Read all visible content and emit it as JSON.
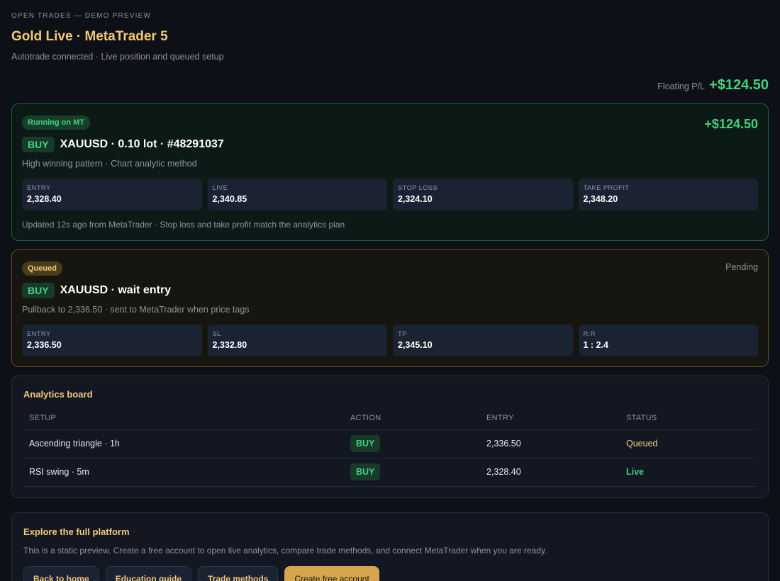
{
  "header": {
    "eyebrow": "OPEN TRADES — DEMO PREVIEW",
    "title": "Gold Live · MetaTrader 5",
    "subtitle": "Autotrade connected · Live position and queued setup",
    "floating_label": "Floating P/L",
    "floating_value": "+$124.50"
  },
  "live_card": {
    "status": "Running on MT",
    "pl": "+$124.50",
    "side": "BUY",
    "title": "XAUUSD · 0.10 lot · #48291037",
    "description": "High winning pattern · Chart analytic method",
    "metrics": [
      {
        "label": "ENTRY",
        "value": "2,328.40"
      },
      {
        "label": "LIVE",
        "value": "2,340.85"
      },
      {
        "label": "STOP LOSS",
        "value": "2,324.10"
      },
      {
        "label": "TAKE PROFIT",
        "value": "2,348.20"
      }
    ],
    "footer": "Updated 12s ago from MetaTrader · Stop loss and take profit match the analytics plan"
  },
  "queued_card": {
    "status": "Queued",
    "state": "Pending",
    "side": "BUY",
    "title": "XAUUSD · wait entry",
    "description": "Pullback to 2,336.50 · sent to MetaTrader when price tags",
    "metrics": [
      {
        "label": "ENTRY",
        "value": "2,336.50"
      },
      {
        "label": "SL",
        "value": "2,332.80"
      },
      {
        "label": "TP",
        "value": "2,345.10"
      },
      {
        "label": "R:R",
        "value": "1 : 2.4"
      }
    ]
  },
  "analytics": {
    "title": "Analytics board",
    "columns": [
      "SETUP",
      "ACTION",
      "ENTRY",
      "STATUS"
    ],
    "rows": [
      {
        "setup": "Ascending triangle · 1h",
        "action": "BUY",
        "entry": "2,336.50",
        "status": "Queued"
      },
      {
        "setup": "RSI swing · 5m",
        "action": "BUY",
        "entry": "2,328.40",
        "status": "Live"
      }
    ]
  },
  "explore": {
    "title": "Explore the full platform",
    "description": "This is a static preview. Create a free account to open live analytics, compare trade methods, and connect MetaTrader when you are ready.",
    "buttons": {
      "home": "Back to home",
      "education": "Education guide",
      "methods": "Trade methods",
      "create": "Create free account"
    }
  },
  "colors": {
    "accent_gold": "#f2c97a",
    "positive_green": "#43d27c",
    "background": "#0d1016"
  }
}
